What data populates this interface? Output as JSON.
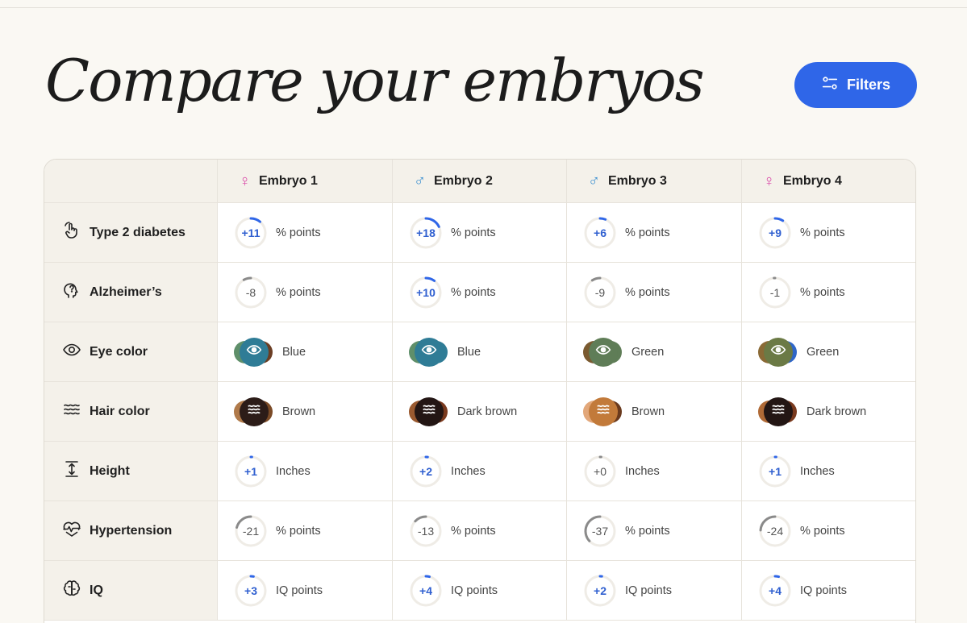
{
  "title": "Compare your embryos",
  "filters_label": "Filters",
  "embryos": [
    {
      "name": "Embryo 1",
      "sex": "female"
    },
    {
      "name": "Embryo 2",
      "sex": "male"
    },
    {
      "name": "Embryo 3",
      "sex": "male"
    },
    {
      "name": "Embryo 4",
      "sex": "female"
    }
  ],
  "rows": [
    {
      "label": "Type 2 diabetes",
      "icon": "hand-tap-icon",
      "kind": "ring",
      "unit": "% points",
      "values": [
        {
          "text": "+11",
          "fraction": 0.11
        },
        {
          "text": "+18",
          "fraction": 0.18
        },
        {
          "text": "+6",
          "fraction": 0.06
        },
        {
          "text": "+9",
          "fraction": 0.09
        }
      ]
    },
    {
      "label": "Alzheimer’s",
      "icon": "head-question-icon",
      "kind": "ring",
      "unit": "% points",
      "values": [
        {
          "text": "-8",
          "fraction": -0.08
        },
        {
          "text": "+10",
          "fraction": 0.1
        },
        {
          "text": "-9",
          "fraction": -0.09
        },
        {
          "text": "-1",
          "fraction": -0.01
        }
      ]
    },
    {
      "label": "Eye color",
      "icon": "eye-icon",
      "kind": "eye",
      "values": [
        {
          "text": "Blue",
          "main": "#2f7c96",
          "left": "#5f8f6a",
          "right": "#6b3e24"
        },
        {
          "text": "Blue",
          "main": "#2f7c96",
          "left": "#5f8f6a",
          "right": "#2f7c96"
        },
        {
          "text": "Green",
          "main": "#5f7d57",
          "left": "#7a5a30",
          "right": "#5f7d57"
        },
        {
          "text": "Green",
          "main": "#6b7a45",
          "left": "#8a6a36",
          "right": "#2f66c8"
        }
      ]
    },
    {
      "label": "Hair color",
      "icon": "waves-icon",
      "kind": "hair",
      "values": [
        {
          "text": "Brown",
          "main": "#2c1c18",
          "left": "#b07a4a",
          "right": "#7a4a26"
        },
        {
          "text": "Dark brown",
          "main": "#231614",
          "left": "#9a5a30",
          "right": "#7a3a1e"
        },
        {
          "text": "Brown",
          "main": "#c27a3a",
          "left": "#e2a77a",
          "right": "#6a3a1e"
        },
        {
          "text": "Dark brown",
          "main": "#231614",
          "left": "#b06a36",
          "right": "#7a3a1e"
        }
      ]
    },
    {
      "label": "Height",
      "icon": "height-arrows-icon",
      "kind": "ring",
      "unit": "Inches",
      "values": [
        {
          "text": "+1",
          "fraction": 0.01
        },
        {
          "text": "+2",
          "fraction": 0.02
        },
        {
          "text": "+0",
          "fraction": 0
        },
        {
          "text": "+1",
          "fraction": 0.01
        }
      ]
    },
    {
      "label": "Hypertension",
      "icon": "heartbeat-icon",
      "kind": "ring",
      "unit": "% points",
      "values": [
        {
          "text": "-21",
          "fraction": -0.21
        },
        {
          "text": "-13",
          "fraction": -0.13
        },
        {
          "text": "-37",
          "fraction": -0.37
        },
        {
          "text": "-24",
          "fraction": -0.24
        }
      ]
    },
    {
      "label": "IQ",
      "icon": "brain-icon",
      "kind": "ring",
      "unit": "IQ points",
      "values": [
        {
          "text": "+3",
          "fraction": 0.03
        },
        {
          "text": "+4",
          "fraction": 0.04
        },
        {
          "text": "+2",
          "fraction": 0.02
        },
        {
          "text": "+4",
          "fraction": 0.04
        }
      ]
    }
  ],
  "colors": {
    "accent": "#2f66e8",
    "positive": "#2f5fd0",
    "negative": "#8a8a8a"
  }
}
